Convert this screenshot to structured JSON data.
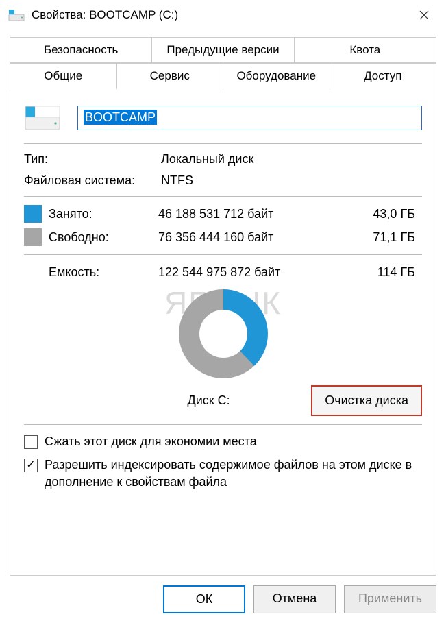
{
  "window": {
    "title": "Свойства: BOOTCAMP (C:)"
  },
  "tabs": {
    "row1": [
      "Безопасность",
      "Предыдущие версии",
      "Квота"
    ],
    "row2": [
      "Общие",
      "Сервис",
      "Оборудование",
      "Доступ"
    ],
    "active": "Общие"
  },
  "drive": {
    "name": "BOOTCAMP",
    "type_label": "Тип:",
    "type_value": "Локальный диск",
    "fs_label": "Файловая система:",
    "fs_value": "NTFS"
  },
  "space": {
    "used_label": "Занято:",
    "used_bytes": "46 188 531 712 байт",
    "used_gb": "43,0 ГБ",
    "free_label": "Свободно:",
    "free_bytes": "76 356 444 160 байт",
    "free_gb": "71,1 ГБ",
    "capacity_label": "Емкость:",
    "capacity_bytes": "122 544 975 872 байт",
    "capacity_gb": "114 ГБ"
  },
  "disk_caption": "Диск C:",
  "cleanup_button": "Очистка диска",
  "checks": {
    "compress": {
      "label": "Сжать этот диск для экономии места",
      "checked": false
    },
    "index": {
      "label": "Разрешить индексировать содержимое файлов на этом диске в дополнение к свойствам файла",
      "checked": true
    }
  },
  "footer": {
    "ok": "OК",
    "cancel": "Отмена",
    "apply": "Применить"
  },
  "watermark": "ЯБЛЫК",
  "chart_data": {
    "type": "pie",
    "title": "Диск C:",
    "series": [
      {
        "name": "Занято",
        "value": 46188531712,
        "color": "#2196d6"
      },
      {
        "name": "Свободно",
        "value": 76356444160,
        "color": "#a6a6a6"
      }
    ],
    "total": 122544975872
  }
}
